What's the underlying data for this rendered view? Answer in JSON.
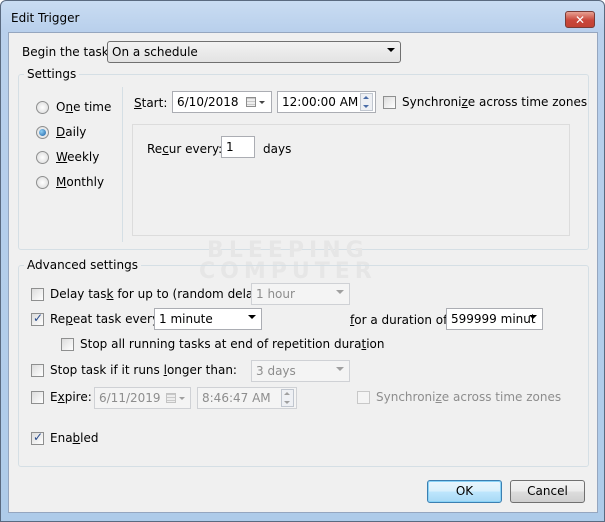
{
  "window": {
    "title": "Edit Trigger",
    "close_label": "✕"
  },
  "begin_task": {
    "label_pre": "Begin the task:",
    "value": "On a schedule"
  },
  "settings": {
    "group_title": "Settings",
    "schedule_options": [
      {
        "label": "One time",
        "underline_index": 1,
        "checked": false
      },
      {
        "label": "Daily",
        "underline_index": 0,
        "checked": true
      },
      {
        "label": "Weekly",
        "underline_index": 0,
        "checked": false
      },
      {
        "label": "Monthly",
        "underline_index": 0,
        "checked": false
      }
    ],
    "start_label": "Start:",
    "start_date": "6/10/2018",
    "start_time": "12:00:00 AM",
    "sync_label": "Synchronize across time zones",
    "sync_checked": false,
    "recur_label": "Recur every:",
    "recur_value": "1",
    "recur_unit": "days"
  },
  "advanced": {
    "group_title": "Advanced settings",
    "delay": {
      "label": "Delay task for up to (random delay):",
      "checked": false,
      "value": "1 hour"
    },
    "repeat": {
      "label": "Repeat task every:",
      "checked": true,
      "value": "1 minute"
    },
    "duration": {
      "label": "for a duration of:",
      "value": "599999 minut"
    },
    "stop_all": {
      "label": "Stop all running tasks at end of repetition duration",
      "checked": false
    },
    "stop_if_longer": {
      "label": "Stop task if it runs longer than:",
      "checked": false,
      "value": "3 days"
    },
    "expire": {
      "label": "Expire:",
      "checked": false,
      "date": "6/11/2019",
      "time": "8:46:47 AM"
    },
    "expire_sync": {
      "label": "Synchronize across time zones",
      "checked": false
    },
    "enabled": {
      "label": "Enabled",
      "checked": true
    }
  },
  "watermark": {
    "line1": "BLEEPING",
    "line2": "COMPUTER"
  },
  "buttons": {
    "ok": "OK",
    "cancel": "Cancel"
  }
}
